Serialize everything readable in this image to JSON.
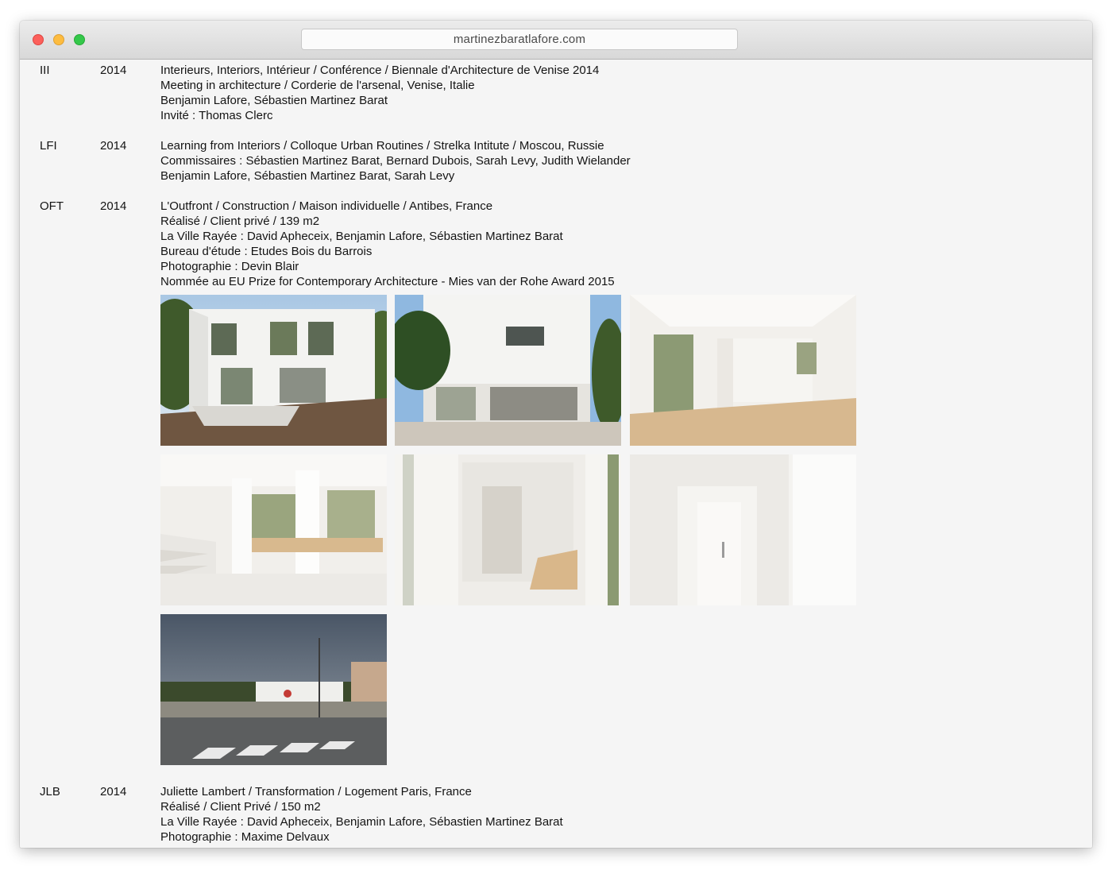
{
  "browser": {
    "url": "martinezbaratlafore.com"
  },
  "entries": [
    {
      "code": "III",
      "year": "2014",
      "lines": [
        "Interieurs, Interiors, Intérieur / Conférence / Biennale d'Architecture de Venise 2014",
        "Meeting in architecture / Corderie de l'arsenal, Venise, Italie",
        "Benjamin Lafore, Sébastien Martinez Barat",
        "Invité : Thomas Clerc"
      ]
    },
    {
      "code": "LFI",
      "year": "2014",
      "lines": [
        "Learning from Interiors / Colloque Urban Routines / Strelka Intitute / Moscou, Russie",
        "Commissaires : Sébastien Martinez Barat, Bernard Dubois, Sarah Levy, Judith Wielander",
        "Benjamin Lafore, Sébastien Martinez Barat, Sarah Levy"
      ]
    },
    {
      "code": "OFT",
      "year": "2014",
      "lines": [
        "L'Outfront / Construction / Maison individuelle / Antibes, France",
        "Réalisé / Client privé / 139 m2",
        "La Ville Rayée : David Apheceix, Benjamin Lafore, Sébastien Martinez Barat",
        "Bureau d'étude : Etudes Bois du Barrois",
        "Photographie : Devin Blair",
        "Nommée au EU Prize for Contemporary Architecture - Mies van der Rohe Award 2015"
      ],
      "photos": [
        "house-exterior-front-photo",
        "house-exterior-side-photo",
        "interior-open-room-photo",
        "interior-stairs-photo",
        "interior-corridor-photo",
        "interior-door-photo",
        "street-view-photo"
      ]
    },
    {
      "code": "JLB",
      "year": "2014",
      "lines": [
        "Juliette Lambert / Transformation / Logement Paris, France",
        "Réalisé / Client Privé / 150 m2",
        "La Ville Rayée : David Apheceix, Benjamin Lafore, Sébastien Martinez Barat",
        "Photographie : Maxime Delvaux"
      ]
    }
  ]
}
